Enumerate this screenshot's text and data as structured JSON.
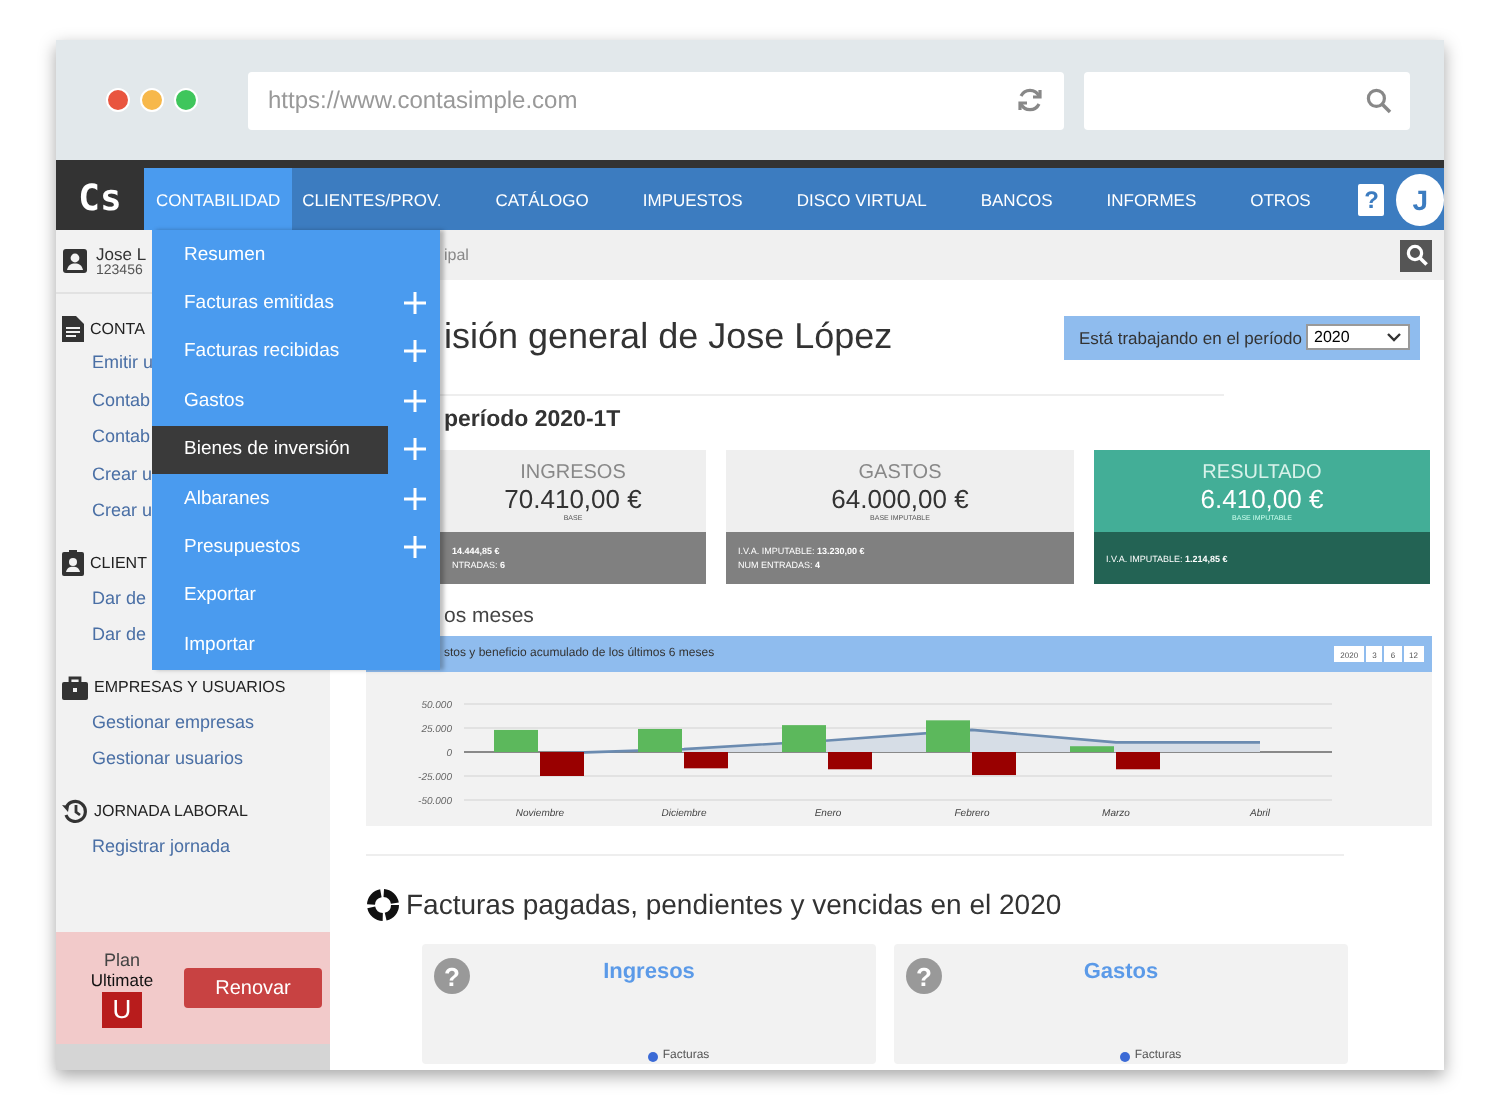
{
  "browser": {
    "url": "https://www.contasimple.com"
  },
  "app": {
    "logo": "Cs",
    "help": "?",
    "avatar": "J",
    "nav": [
      {
        "label": "CONTABILIDAD",
        "selected": true
      },
      {
        "label": "CLIENTES/PROV.",
        "selected": false
      },
      {
        "label": "CATÁLOGO",
        "selected": false
      },
      {
        "label": "IMPUESTOS",
        "selected": false
      },
      {
        "label": "DISCO VIRTUAL",
        "selected": false
      },
      {
        "label": "BANCOS",
        "selected": false
      },
      {
        "label": "INFORMES",
        "selected": false
      },
      {
        "label": "OTROS",
        "selected": false
      }
    ]
  },
  "sidebar": {
    "user": {
      "name": "Jose L",
      "id": "123456"
    },
    "sections": [
      {
        "title": "CONTA",
        "links": [
          "Emitir u",
          "Contab",
          "Contab",
          "Crear u",
          "Crear u"
        ]
      },
      {
        "title": "CLIENT",
        "links": [
          "Dar de",
          "Dar de"
        ]
      },
      {
        "title": "EMPRESAS Y USUARIOS",
        "links": [
          "Gestionar empresas",
          "Gestionar usuarios"
        ]
      },
      {
        "title": "JORNADA LABORAL",
        "links": [
          "Registrar jornada"
        ]
      }
    ],
    "plan": {
      "label": "Plan",
      "name": "Ultimate",
      "badge": "U",
      "button": "Renovar"
    }
  },
  "menu": {
    "items": [
      {
        "label": "Resumen",
        "expandable": false,
        "selected": false
      },
      {
        "label": "Facturas emitidas",
        "expandable": true,
        "selected": false
      },
      {
        "label": "Facturas recibidas",
        "expandable": true,
        "selected": false
      },
      {
        "label": "Gastos",
        "expandable": true,
        "selected": false
      },
      {
        "label": "Bienes de inversión",
        "expandable": true,
        "selected": true
      },
      {
        "label": "Albaranes",
        "expandable": true,
        "selected": false
      },
      {
        "label": "Presupuestos",
        "expandable": true,
        "selected": false
      },
      {
        "label": "Exportar",
        "expandable": false,
        "selected": false
      },
      {
        "label": "Importar",
        "expandable": false,
        "selected": false
      }
    ]
  },
  "breadcrumb": "ipal",
  "title": "isión general de Jose López",
  "period_selector": {
    "label": "Está trabajando en el período",
    "value": "2020"
  },
  "period_heading": "período 2020-1T",
  "kpis": [
    {
      "kind": "neutral",
      "title": "INGRESOS",
      "value": "70.410,00 €",
      "sublabel": "BASE",
      "details": [
        "**14.444,85 €**",
        "NTRADAS: **6**"
      ]
    },
    {
      "kind": "neutral",
      "title": "GASTOS",
      "value": "64.000,00 €",
      "sublabel": "BASE IMPUTABLE",
      "details": [
        "I.V.A. IMPUTABLE: **13.230,00 €**",
        "NUM ENTRADAS: **4**"
      ]
    },
    {
      "kind": "positive",
      "title": "RESULTADO",
      "value": "6.410,00 €",
      "sublabel": "BASE IMPUTABLE",
      "details": [
        "I.V.A. IMPUTABLE: **1.214,85 €**"
      ]
    }
  ],
  "months_heading": "os meses",
  "chart": {
    "title": "stos y beneficio acumulado de los últimos 6 meses",
    "ranges": [
      "2020",
      "3",
      "6",
      "12"
    ],
    "chart_data": {
      "type": "bar",
      "stacked": false,
      "categories": [
        "Noviembre",
        "Diciembre",
        "Enero",
        "Febrero",
        "Marzo",
        "Abril"
      ],
      "ylim": [
        -50000,
        50000
      ],
      "yticks": [
        {
          "value": 50000,
          "label": "50.000"
        },
        {
          "value": 25000,
          "label": "25.000"
        },
        {
          "value": 0,
          "label": "0"
        },
        {
          "value": -25000,
          "label": "-25.000"
        },
        {
          "value": -50000,
          "label": "-50.000"
        }
      ],
      "series": [
        {
          "type": "bar",
          "color": "#5cb85c",
          "values": [
            23000,
            24000,
            28000,
            33000,
            6000,
            0
          ]
        },
        {
          "type": "bar",
          "color": "#990000",
          "values": [
            -25000,
            -17000,
            -18000,
            -24000,
            -18000,
            0
          ]
        },
        {
          "type": "line",
          "color": "#6b8bb0",
          "values": [
            -2000,
            3000,
            12000,
            23000,
            10000,
            10000
          ]
        }
      ]
    }
  },
  "invoices": {
    "heading": "Facturas pagadas, pendientes y vencidas en el 2020",
    "cards": [
      {
        "help": "?",
        "title": "Ingresos",
        "legend": "Facturas"
      },
      {
        "help": "?",
        "title": "Gastos",
        "legend": "Facturas"
      }
    ]
  }
}
